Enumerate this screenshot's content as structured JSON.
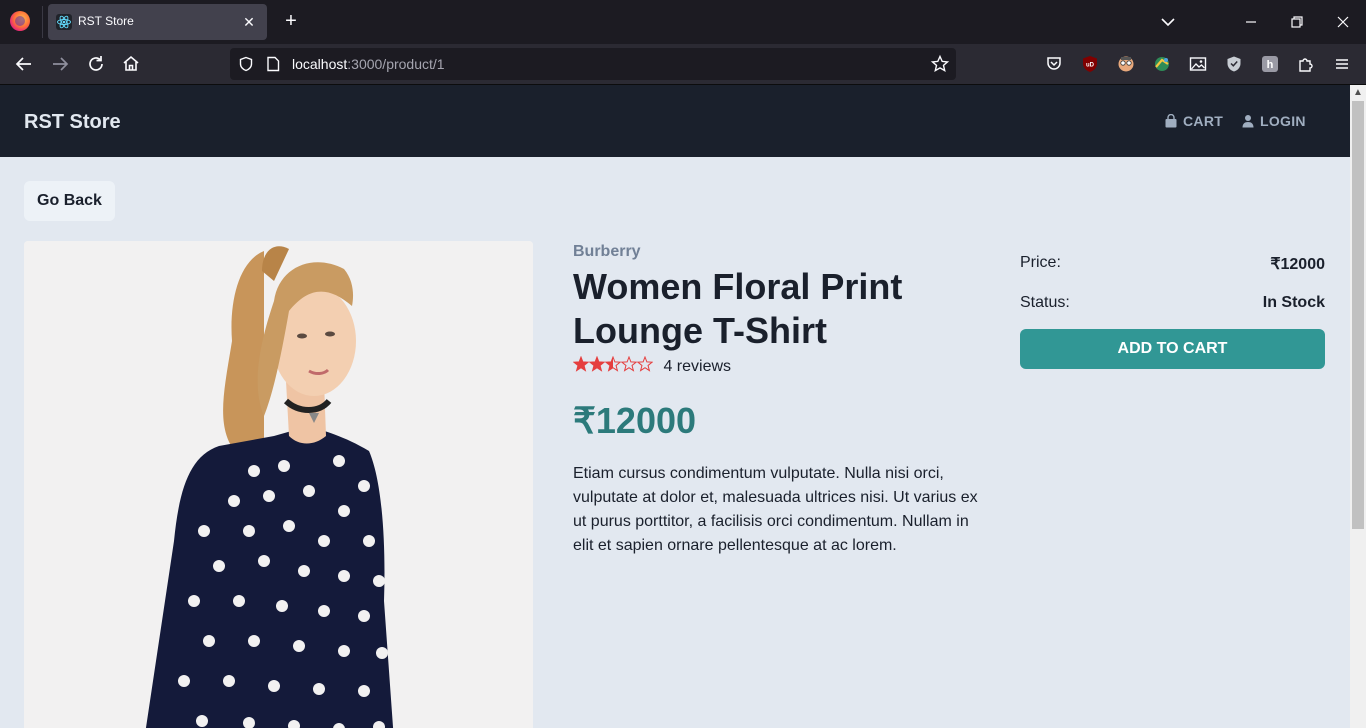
{
  "browser": {
    "tab_title": "RST Store",
    "tab_close": "✕",
    "new_tab": "+",
    "url_host": "localhost",
    "url_path": ":3000/product/1"
  },
  "header": {
    "brand": "RST Store",
    "cart_label": "CART",
    "login_label": "LOGIN"
  },
  "page": {
    "go_back_label": "Go Back"
  },
  "product": {
    "brand": "Burberry",
    "title": "Women Floral Print Lounge T-Shirt",
    "rating": 2.5,
    "rating_max": 5,
    "reviews": "4 reviews",
    "price": "₹12000",
    "description": "Etiam cursus condimentum vulputate. Nulla nisi orci, vulputate at dolor et, malesuada ultrices nisi. Ut varius ex ut purus porttitor, a facilisis orci condimentum. Nullam in elit et sapien ornare pellentesque at ac lorem."
  },
  "summary": {
    "price_label": "Price:",
    "price_value": "₹12000",
    "status_label": "Status:",
    "status_value": "In Stock",
    "add_to_cart_label": "ADD TO CART"
  },
  "colors": {
    "header_bg": "#1a202c",
    "page_bg": "#e2e8f0",
    "accent": "#319795",
    "price": "#2c7a7b",
    "star": "#e53e3e"
  }
}
